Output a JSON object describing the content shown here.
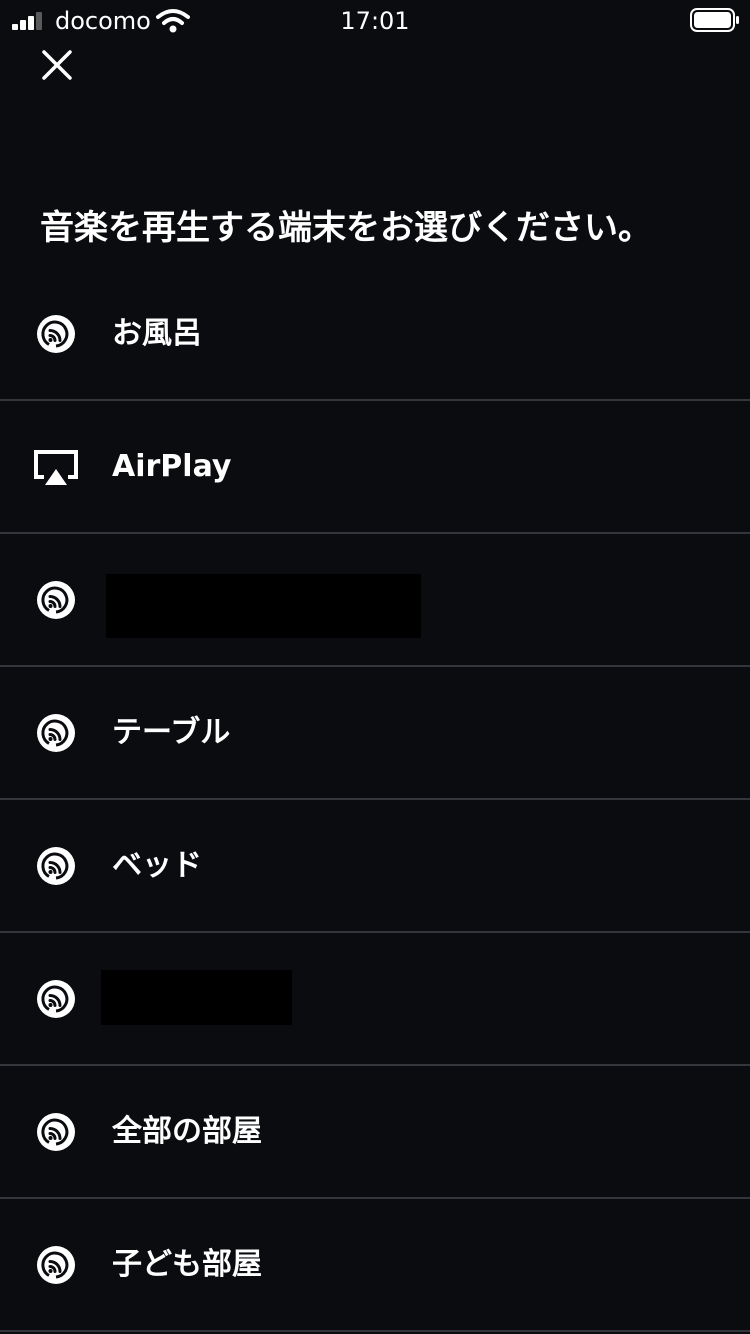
{
  "status_bar": {
    "carrier": "docomo",
    "time": "17:01"
  },
  "header": {
    "title": "音楽を再生する端末をお選びください。"
  },
  "devices": [
    {
      "label": "お風呂",
      "icon": "speaker-icon"
    },
    {
      "label": "AirPlay",
      "icon": "airplay-icon"
    },
    {
      "label": "",
      "icon": "speaker-icon",
      "redacted": true
    },
    {
      "label": "テーブル",
      "icon": "speaker-icon"
    },
    {
      "label": "ベッド",
      "icon": "speaker-icon"
    },
    {
      "label": "",
      "icon": "speaker-icon",
      "redacted": true
    },
    {
      "label": "全部の部屋",
      "icon": "speaker-icon"
    },
    {
      "label": "子ども部屋",
      "icon": "speaker-icon"
    }
  ],
  "colors": {
    "background": "#0b0c10",
    "divider": "#35363b",
    "text": "#ffffff"
  }
}
